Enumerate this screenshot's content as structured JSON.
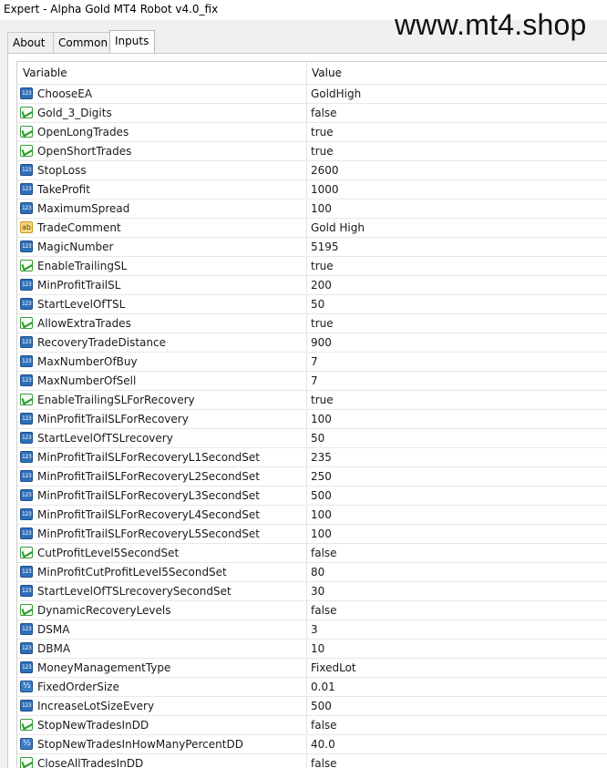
{
  "window": {
    "title": "Expert - Alpha Gold MT4 Robot v4.0_fix"
  },
  "watermark": "www.mt4.shop",
  "tabs": [
    {
      "label": "About",
      "active": false
    },
    {
      "label": "Common",
      "active": false
    },
    {
      "label": "Inputs",
      "active": true
    }
  ],
  "table": {
    "headers": {
      "variable": "Variable",
      "value": "Value"
    },
    "rows": [
      {
        "type": "int",
        "name": "ChooseEA",
        "value": "GoldHigh"
      },
      {
        "type": "bool",
        "name": "Gold_3_Digits",
        "value": "false"
      },
      {
        "type": "bool",
        "name": "OpenLongTrades",
        "value": "true"
      },
      {
        "type": "bool",
        "name": "OpenShortTrades",
        "value": "true"
      },
      {
        "type": "int",
        "name": "StopLoss",
        "value": "2600"
      },
      {
        "type": "int",
        "name": "TakeProfit",
        "value": "1000"
      },
      {
        "type": "int",
        "name": "MaximumSpread",
        "value": "100"
      },
      {
        "type": "str",
        "name": "TradeComment",
        "value": "Gold High"
      },
      {
        "type": "int",
        "name": "MagicNumber",
        "value": "5195"
      },
      {
        "type": "bool",
        "name": "EnableTrailingSL",
        "value": "true"
      },
      {
        "type": "int",
        "name": "MinProfitTrailSL",
        "value": "200"
      },
      {
        "type": "int",
        "name": "StartLevelOfTSL",
        "value": "50"
      },
      {
        "type": "bool",
        "name": "AllowExtraTrades",
        "value": "true"
      },
      {
        "type": "int",
        "name": "RecoveryTradeDistance",
        "value": "900"
      },
      {
        "type": "int",
        "name": "MaxNumberOfBuy",
        "value": "7"
      },
      {
        "type": "int",
        "name": "MaxNumberOfSell",
        "value": "7"
      },
      {
        "type": "bool",
        "name": "EnableTrailingSLForRecovery",
        "value": "true"
      },
      {
        "type": "int",
        "name": "MinProfitTrailSLForRecovery",
        "value": "100"
      },
      {
        "type": "int",
        "name": "StartLevelOfTSLrecovery",
        "value": "50"
      },
      {
        "type": "int",
        "name": "MinProfitTrailSLForRecoveryL1SecondSet",
        "value": "235"
      },
      {
        "type": "int",
        "name": "MinProfitTrailSLForRecoveryL2SecondSet",
        "value": "250"
      },
      {
        "type": "int",
        "name": "MinProfitTrailSLForRecoveryL3SecondSet",
        "value": "500"
      },
      {
        "type": "int",
        "name": "MinProfitTrailSLForRecoveryL4SecondSet",
        "value": "100"
      },
      {
        "type": "int",
        "name": "MinProfitTrailSLForRecoveryL5SecondSet",
        "value": "100"
      },
      {
        "type": "bool",
        "name": "CutProfitLevel5SecondSet",
        "value": "false"
      },
      {
        "type": "int",
        "name": "MinProfitCutProfitLevel5SecondSet",
        "value": "80"
      },
      {
        "type": "int",
        "name": "StartLevelOfTSLrecoverySecondSet",
        "value": "30"
      },
      {
        "type": "bool",
        "name": "DynamicRecoveryLevels",
        "value": "false"
      },
      {
        "type": "int",
        "name": "DSMA",
        "value": "3"
      },
      {
        "type": "int",
        "name": "DBMA",
        "value": "10"
      },
      {
        "type": "int",
        "name": "MoneyManagementType",
        "value": "FixedLot"
      },
      {
        "type": "dbl",
        "name": "FixedOrderSize",
        "value": "0.01"
      },
      {
        "type": "int",
        "name": "IncreaseLotSizeEvery",
        "value": "500"
      },
      {
        "type": "bool",
        "name": "StopNewTradesInDD",
        "value": "false"
      },
      {
        "type": "dbl",
        "name": "StopNewTradesInHowManyPercentDD",
        "value": "40.0"
      },
      {
        "type": "bool",
        "name": "CloseAllTradesInDD",
        "value": "false"
      }
    ]
  }
}
